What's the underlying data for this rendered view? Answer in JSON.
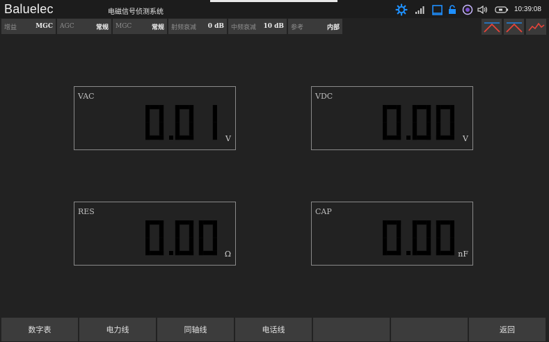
{
  "header": {
    "brand": "Baluelec",
    "title": "电磁信号侦测系统",
    "time": "10:39:08"
  },
  "status_icons": [
    "settings-gear-icon",
    "signal-bars-icon",
    "window-square-icon",
    "lock-icon",
    "record-circle-icon",
    "volume-icon",
    "battery-icon"
  ],
  "info_boxes": [
    {
      "label": "增益",
      "value": "MGC"
    },
    {
      "label": "AGC",
      "value": "常规"
    },
    {
      "label": "MGC",
      "value": "常规"
    },
    {
      "label": "射频衰减",
      "value": "0 dB"
    },
    {
      "label": "中频衰减",
      "value": "10 dB"
    },
    {
      "label": "参考",
      "value": "内部"
    }
  ],
  "trace_buttons": [
    "peak-trace-icon",
    "peak-trace-icon",
    "spectrum-trace-icon"
  ],
  "meters": [
    {
      "label": "VAC",
      "value": "0.01",
      "unit": "V"
    },
    {
      "label": "VDC",
      "value": "0.00",
      "unit": "V"
    },
    {
      "label": "RES",
      "value": "0.00",
      "unit": "Ω"
    },
    {
      "label": "CAP",
      "value": "0.00",
      "unit": "nF"
    }
  ],
  "bottom_buttons": [
    "数字表",
    "电力线",
    "同轴线",
    "电话线",
    "",
    "",
    "返回"
  ],
  "colors": {
    "background": "#222222",
    "panel": "#3a3a3a",
    "accent": "#1e90ff",
    "trace": "#e8443a"
  }
}
